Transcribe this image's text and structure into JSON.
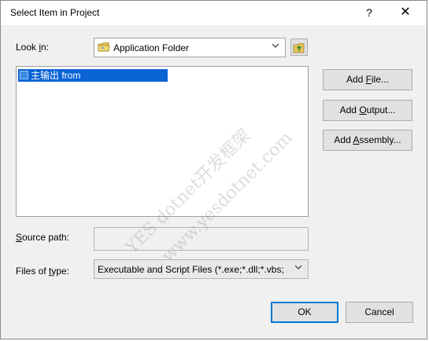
{
  "window": {
    "title": "Select Item in Project",
    "help_label": "?",
    "close_label": "✕"
  },
  "look_in": {
    "label_prefix": "Look ",
    "label_accel": "i",
    "label_suffix": "n:",
    "value": "Application Folder",
    "icon": "folder-icon"
  },
  "up_folder_icon": "folder-up-icon",
  "list": {
    "items": [
      {
        "label": "主输出 from",
        "selected": true
      }
    ]
  },
  "buttons": {
    "add_file": {
      "pre": "Add ",
      "accel": "F",
      "post": "ile..."
    },
    "add_output": {
      "pre": "Add ",
      "accel": "O",
      "post": "utput..."
    },
    "add_assembly": {
      "pre": "Add ",
      "accel": "A",
      "post": "ssembly..."
    },
    "ok": "OK",
    "cancel": "Cancel"
  },
  "source_path": {
    "label_accel": "S",
    "label_rest": "ource path:",
    "value": ""
  },
  "files_of_type": {
    "label_prefix": "Files of ",
    "label_accel": "t",
    "label_suffix": "ype:",
    "value": "Executable and Script Files (*.exe;*.dll;*.vbs;"
  },
  "watermark": {
    "line1": "YES dotnet开发框架",
    "line2": "www.yesdotnet.com"
  },
  "colors": {
    "dialog_bg": "#f0f0f0",
    "selection": "#0a64d6",
    "default_button_border": "#0078d7"
  }
}
